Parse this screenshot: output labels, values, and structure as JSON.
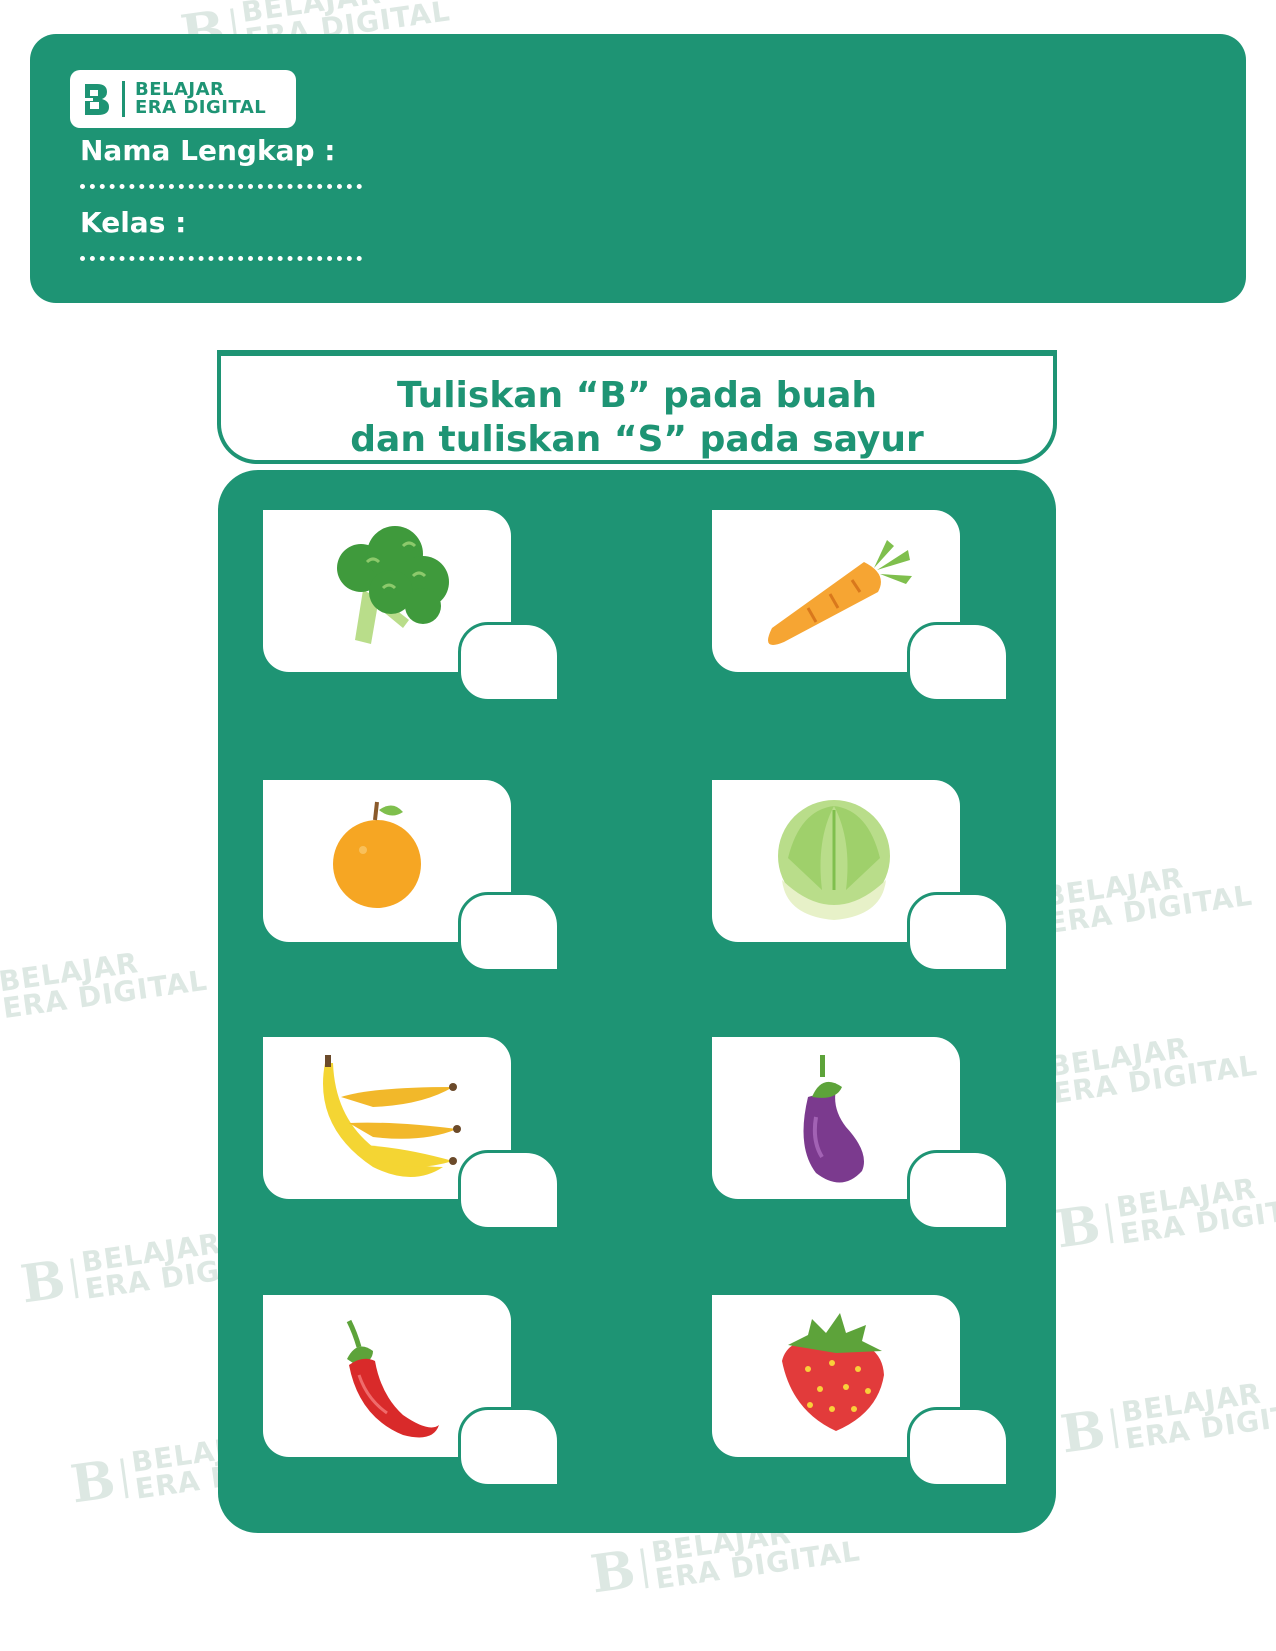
{
  "brand": {
    "line1": "BELAJAR",
    "line2": "ERA DIGITAL"
  },
  "form": {
    "name_label": "Nama Lengkap :",
    "class_label": "Kelas :"
  },
  "instruction": {
    "line1": "Tuliskan “B” pada buah",
    "line2": "dan tuliskan “S” pada sayur"
  },
  "items": [
    {
      "icon": "broccoli-icon"
    },
    {
      "icon": "carrot-icon"
    },
    {
      "icon": "orange-icon"
    },
    {
      "icon": "cabbage-icon"
    },
    {
      "icon": "banana-icon"
    },
    {
      "icon": "eggplant-icon"
    },
    {
      "icon": "chili-icon"
    },
    {
      "icon": "strawberry-icon"
    }
  ],
  "colors": {
    "primary": "#1e9474",
    "watermark": "#dde8e3"
  }
}
